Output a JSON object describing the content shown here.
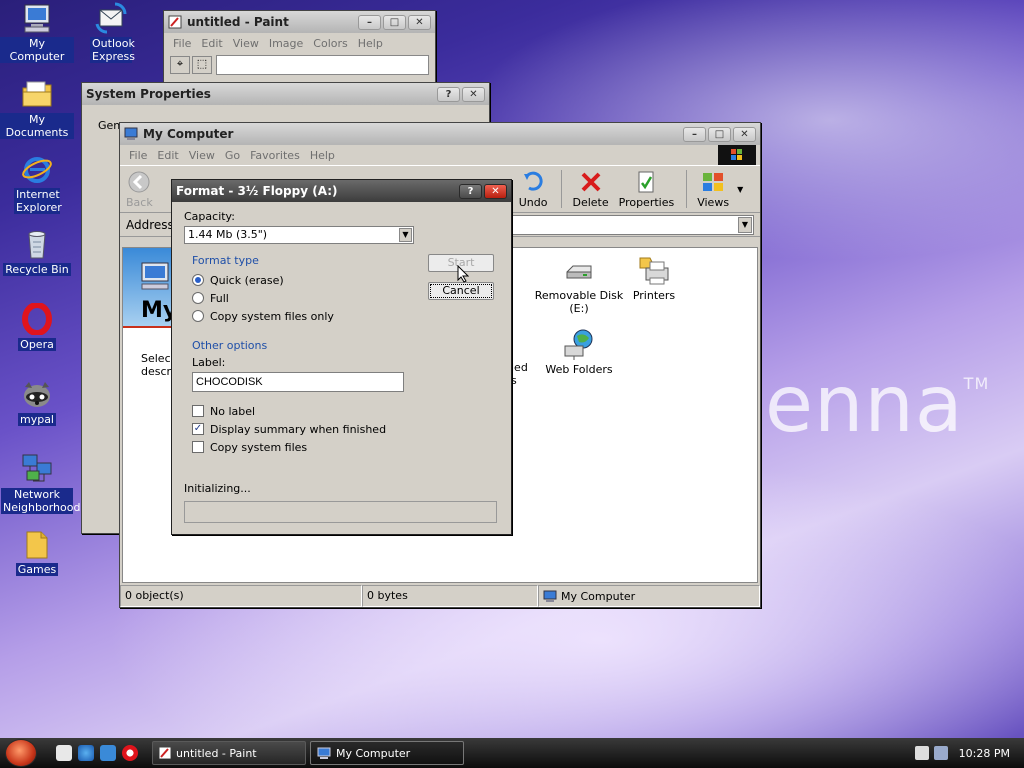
{
  "wallpaper": {
    "wordmark": "enna",
    "tm": "TM"
  },
  "desktop": {
    "icons": [
      {
        "label": "My Computer"
      },
      {
        "label": "Outlook Express"
      },
      {
        "label": "My Documents"
      },
      {
        "label": "Internet Explorer"
      },
      {
        "label": "Recycle Bin"
      },
      {
        "label": "Opera"
      },
      {
        "label": "mypal"
      },
      {
        "label": "Network Neighborhood"
      },
      {
        "label": "Games"
      }
    ]
  },
  "paint": {
    "title": "untitled - Paint",
    "menu": [
      "File",
      "Edit",
      "View",
      "Image",
      "Colors",
      "Help"
    ]
  },
  "sysprops": {
    "title": "System Properties",
    "tab": "Gene"
  },
  "mycomputer": {
    "title": "My Computer",
    "menu": [
      "File",
      "Edit",
      "View",
      "Go",
      "Favorites",
      "Help"
    ],
    "toolbar": {
      "back": "Back",
      "undo": "Undo",
      "delete": "Delete",
      "properties": "Properties",
      "views": "Views"
    },
    "address_label": "Address",
    "panel_heading": "My",
    "panel_text_1": "Selec",
    "panel_text_2": "descr",
    "items": {
      "removable": "Removable Disk (E:)",
      "printers": "Printers",
      "web_folders": "Web Folders",
      "partial_1": "led",
      "partial_2": "s"
    },
    "status": {
      "objects": "0 object(s)",
      "bytes": "0 bytes",
      "location": "My Computer"
    }
  },
  "format": {
    "title": "Format - 3½ Floppy (A:)",
    "capacity_label": "Capacity:",
    "capacity_value": "1.44 Mb (3.5\")",
    "start_label": "Start",
    "cancel_label": "Cancel",
    "format_type_label": "Format type",
    "options": [
      "Quick (erase)",
      "Full",
      "Copy system files only"
    ],
    "selected_option": "Quick (erase)",
    "other_options_label": "Other options",
    "label_label": "Label:",
    "label_value": "CHOCODISK",
    "checks": [
      {
        "label": "No label",
        "checked": false
      },
      {
        "label": "Display summary when finished",
        "checked": true
      },
      {
        "label": "Copy system files",
        "checked": false
      }
    ],
    "status": "Initializing..."
  },
  "taskbar": {
    "tasks": [
      {
        "label": "untitled - Paint",
        "active": false
      },
      {
        "label": "My Computer",
        "active": true
      }
    ],
    "clock": "10:28 PM"
  }
}
